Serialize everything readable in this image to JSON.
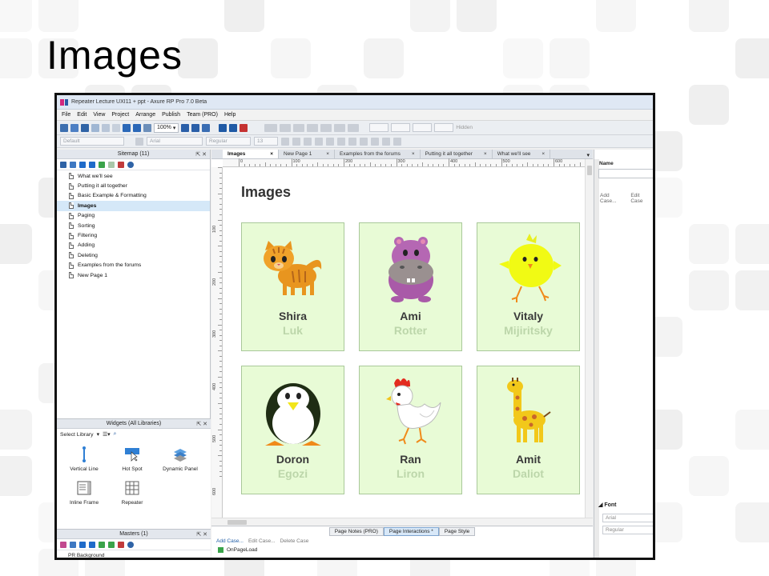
{
  "slide": {
    "title": "Images"
  },
  "window": {
    "title": "Repeater Lecture UXI11 + ppt - Axure RP Pro 7.0 Beta",
    "menu": [
      "File",
      "Edit",
      "View",
      "Project",
      "Arrange",
      "Publish",
      "Team (PRO)",
      "Help"
    ],
    "zoom": "100%",
    "style_fields": {
      "style": "Default",
      "font": "Arial",
      "weight": "Regular",
      "size": "13",
      "hidden_label": "Hidden"
    }
  },
  "sitemap": {
    "header": "Sitemap (11)",
    "pages": [
      {
        "label": "What we'll see",
        "selected": false
      },
      {
        "label": "Putting it all together",
        "selected": false
      },
      {
        "label": "Basic Example & Formatting",
        "selected": false
      },
      {
        "label": "Images",
        "selected": true
      },
      {
        "label": "Paging",
        "selected": false
      },
      {
        "label": "Sorting",
        "selected": false
      },
      {
        "label": "Filtering",
        "selected": false
      },
      {
        "label": "Adding",
        "selected": false
      },
      {
        "label": "Deleting",
        "selected": false
      },
      {
        "label": "Examples from the forums",
        "selected": false
      },
      {
        "label": "New Page 1",
        "selected": false
      }
    ]
  },
  "widgets": {
    "header": "Widgets (All Libraries)",
    "select_library": "Select Library",
    "items": [
      {
        "label": "Vertical Line",
        "icon": "vertical-line-icon"
      },
      {
        "label": "Hot Spot",
        "icon": "hot-spot-icon"
      },
      {
        "label": "Dynamic Panel",
        "icon": "dynamic-panel-icon"
      },
      {
        "label": "Inline Frame",
        "icon": "inline-frame-icon"
      },
      {
        "label": "Repeater",
        "icon": "repeater-icon"
      }
    ]
  },
  "masters": {
    "header": "Masters (1)",
    "first_item": "PR Background"
  },
  "tabs": [
    {
      "label": "Images",
      "active": true
    },
    {
      "label": "New Page 1",
      "active": false
    },
    {
      "label": "Examples from the forums",
      "active": false
    },
    {
      "label": "Putting it all together",
      "active": false
    },
    {
      "label": "What we'll see",
      "active": false
    }
  ],
  "ruler": {
    "h": [
      "0",
      "100",
      "200",
      "300",
      "400",
      "500",
      "600",
      "700"
    ],
    "v": [
      "100",
      "200",
      "300",
      "400",
      "500",
      "600"
    ]
  },
  "canvas": {
    "title": "Images",
    "cards": [
      {
        "first": "Shira",
        "last": "Luk",
        "animal": "cat"
      },
      {
        "first": "Ami",
        "last": "Rotter",
        "animal": "hippo"
      },
      {
        "first": "Vitaly",
        "last": "Mijiritsky",
        "animal": "chick"
      },
      {
        "first": "Doron",
        "last": "Egozi",
        "animal": "penguin"
      },
      {
        "first": "Ran",
        "last": "Liron",
        "animal": "rooster"
      },
      {
        "first": "Amit",
        "last": "Daliot",
        "animal": "giraffe"
      }
    ]
  },
  "bottom_panel": {
    "tabs": [
      {
        "label": "Page Notes (PRO)",
        "active": false
      },
      {
        "label": "Page Interactions *",
        "active": true
      },
      {
        "label": "Page Style",
        "active": false
      }
    ],
    "actions": [
      "Add Case...",
      "Edit Case...",
      "Delete Case"
    ],
    "event": "OnPageLoad"
  },
  "inspector": {
    "name_label": "Name",
    "links": [
      "Add Case...",
      "Edit Case"
    ],
    "font_header": "Font",
    "font_value": "Arial",
    "weight_value": "Regular"
  },
  "colors": {
    "card_bg": "#e8fbd6",
    "card_border": "#a9c89a",
    "selected_row": "#d5e8f8",
    "last_name": "#bcd6aa"
  }
}
